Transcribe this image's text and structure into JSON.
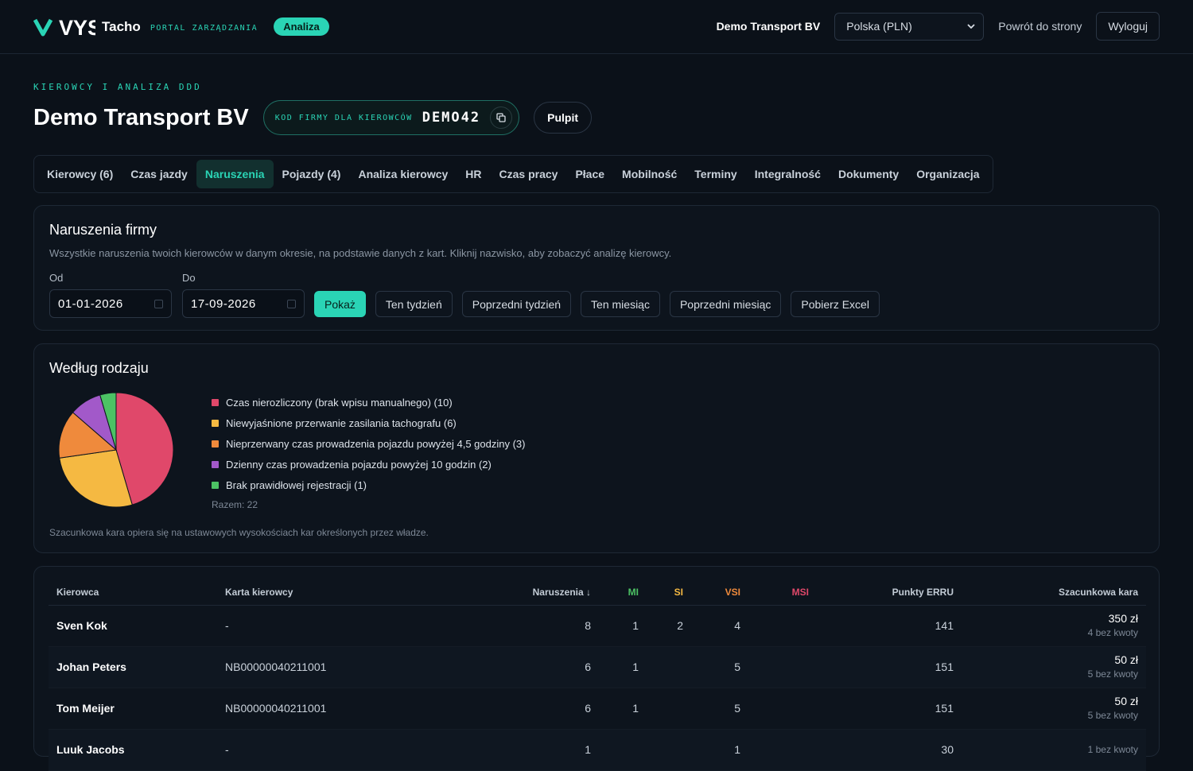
{
  "header": {
    "logo_text": "VYS",
    "brand": "Tacho",
    "brand_sub": "PORTAL ZARZĄDZANIA",
    "badge": "Analiza",
    "company": "Demo Transport BV",
    "country_select": "Polska (PLN)",
    "back_link": "Powrót do strony",
    "logout": "Wyloguj"
  },
  "page": {
    "eyebrow": "KIEROWCY I ANALIZA DDD",
    "title": "Demo Transport BV",
    "code_label": "KOD FIRMY DLA KIEROWCÓW",
    "code_value": "DEMO42",
    "pulpit": "Pulpit"
  },
  "tabs": [
    {
      "label": "Kierowcy (6)"
    },
    {
      "label": "Czas jazdy"
    },
    {
      "label": "Naruszenia",
      "active": true
    },
    {
      "label": "Pojazdy (4)"
    },
    {
      "label": "Analiza kierowcy"
    },
    {
      "label": "HR"
    },
    {
      "label": "Czas pracy"
    },
    {
      "label": "Płace"
    },
    {
      "label": "Mobilność"
    },
    {
      "label": "Terminy"
    },
    {
      "label": "Integralność"
    },
    {
      "label": "Dokumenty"
    },
    {
      "label": "Organizacja"
    }
  ],
  "filters": {
    "title": "Naruszenia firmy",
    "description": "Wszystkie naruszenia twoich kierowców w danym okresie, na podstawie danych z kart. Kliknij nazwisko, aby zobaczyć analizę kierowcy.",
    "from_label": "Od",
    "to_label": "Do",
    "from_value": "01-01-2026",
    "to_value": "17-09-2026",
    "buttons": [
      "Pokaż",
      "Ten tydzień",
      "Poprzedni tydzień",
      "Ten miesiąc",
      "Poprzedni miesiąc",
      "Pobierz Excel"
    ]
  },
  "by_type": {
    "title": "Według rodzaju",
    "total": "Razem: 22",
    "note": "Szacunkowa kara opiera się na ustawowych wysokościach kar określonych przez władze.",
    "items": [
      {
        "label": "Czas nierozliczony (brak wpisu manualnego) (10)",
        "value": 10,
        "color": "#e0486a"
      },
      {
        "label": "Niewyjaśnione przerwanie zasilania tachografu (6)",
        "value": 6,
        "color": "#f5b942"
      },
      {
        "label": "Nieprzerwany czas prowadzenia pojazdu powyżej 4,5 godziny (3)",
        "value": 3,
        "color": "#ef8a3c"
      },
      {
        "label": "Dzienny czas prowadzenia pojazdu powyżej 10 godzin (2)",
        "value": 2,
        "color": "#a259c9"
      },
      {
        "label": "Brak prawidłowej rejestracji (1)",
        "value": 1,
        "color": "#4cc264"
      }
    ]
  },
  "table": {
    "headers": {
      "driver": "Kierowca",
      "card": "Karta kierowcy",
      "violations": "Naruszenia ↓",
      "mi": "MI",
      "si": "SI",
      "vsi": "VSI",
      "msi": "MSI",
      "erru": "Punkty ERRU",
      "fine": "Szacunkowa kara"
    },
    "header_colors": {
      "mi": "#4cc264",
      "si": "#f5b942",
      "vsi": "#ef8a3c",
      "msi": "#e0486a"
    },
    "rows": [
      {
        "driver": "Sven Kok",
        "card": "-",
        "violations": "8",
        "mi": "1",
        "si": "2",
        "vsi": "4",
        "msi": "",
        "erru": "141",
        "fine": "350 zł",
        "fine_sub": "4 bez kwoty"
      },
      {
        "driver": "Johan Peters",
        "card": "NB00000040211001",
        "violations": "6",
        "mi": "1",
        "si": "",
        "vsi": "5",
        "msi": "",
        "erru": "151",
        "fine": "50 zł",
        "fine_sub": "5 bez kwoty"
      },
      {
        "driver": "Tom Meijer",
        "card": "NB00000040211001",
        "violations": "6",
        "mi": "1",
        "si": "",
        "vsi": "5",
        "msi": "",
        "erru": "151",
        "fine": "50 zł",
        "fine_sub": "5 bez kwoty"
      },
      {
        "driver": "Luuk Jacobs",
        "card": "-",
        "violations": "1",
        "mi": "",
        "si": "",
        "vsi": "1",
        "msi": "",
        "erru": "30",
        "fine": "",
        "fine_sub": "1 bez kwoty"
      }
    ]
  }
}
